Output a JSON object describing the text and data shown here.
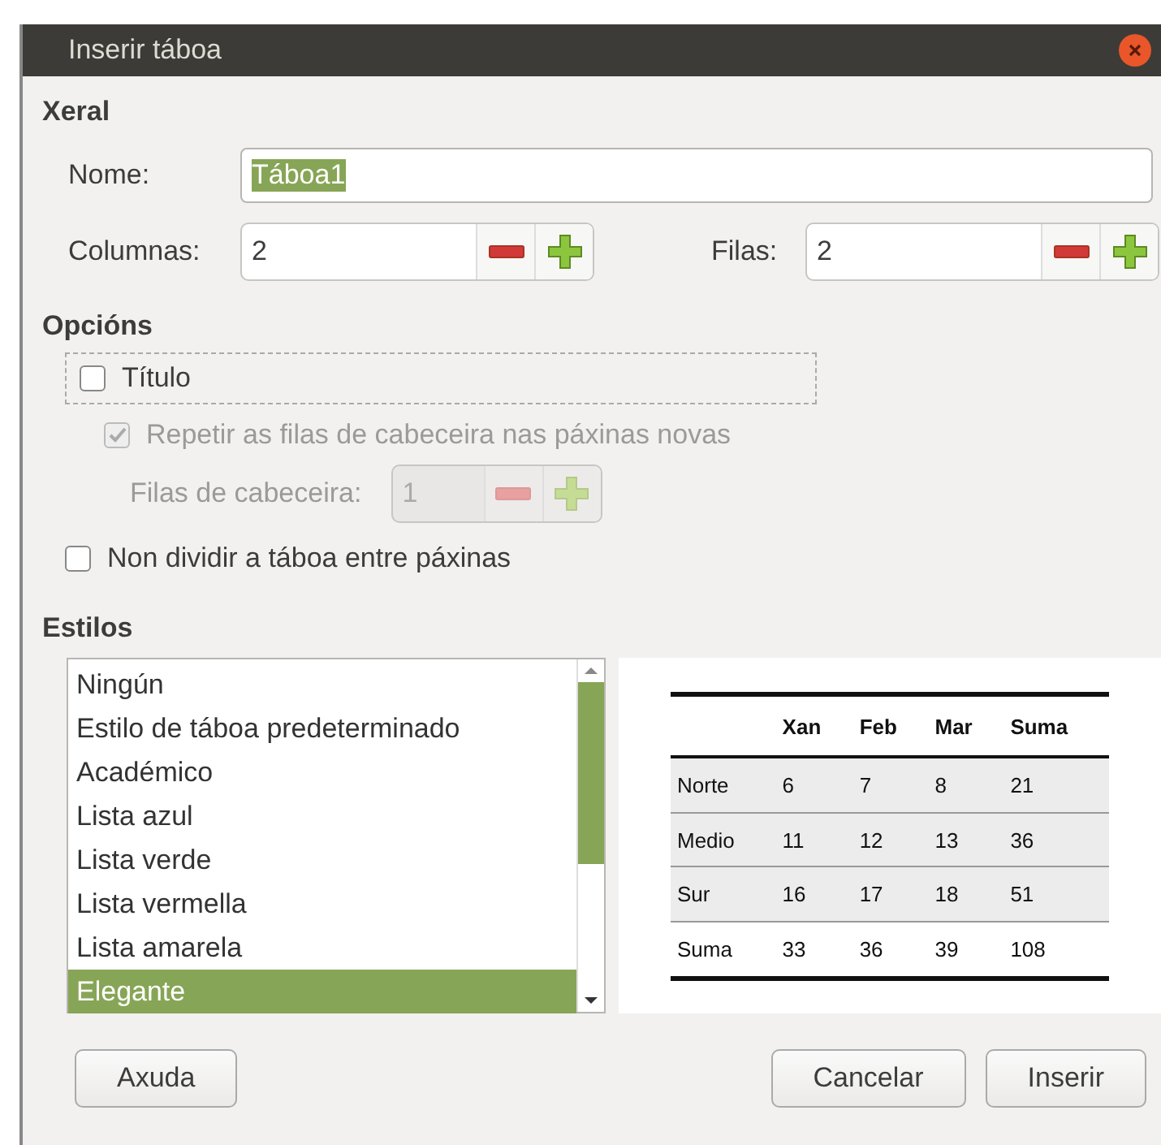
{
  "window": {
    "title": "Inserir táboa"
  },
  "general": {
    "heading": "Xeral",
    "name": {
      "label": "Nome:",
      "value": "Táboa1",
      "value_selected": true
    },
    "columns": {
      "label": "Columnas:",
      "value": "2"
    },
    "rows": {
      "label": "Filas:",
      "value": "2"
    }
  },
  "options": {
    "heading": "Opcións",
    "items": [
      {
        "kind": "checkbox",
        "label": "Título",
        "checked": false,
        "disabled": false,
        "focused": true,
        "children": [
          {
            "kind": "checkbox",
            "label": "Repetir as filas de cabeceira nas páxinas novas",
            "checked": true,
            "disabled": true
          },
          {
            "kind": "spin",
            "label": "Filas de cabeceira:",
            "value": "1",
            "disabled": true
          }
        ]
      },
      {
        "kind": "checkbox",
        "label": "Non dividir a táboa entre páxinas",
        "checked": false,
        "disabled": false
      }
    ]
  },
  "styles": {
    "heading": "Estilos",
    "items": [
      {
        "label": "Ningún",
        "selected": false
      },
      {
        "label": "Estilo de táboa predeterminado",
        "selected": false
      },
      {
        "label": "Académico",
        "selected": false
      },
      {
        "label": "Lista azul",
        "selected": false
      },
      {
        "label": "Lista verde",
        "selected": false
      },
      {
        "label": "Lista vermella",
        "selected": false
      },
      {
        "label": "Lista amarela",
        "selected": false
      },
      {
        "label": "Elegante",
        "selected": true
      }
    ],
    "preview": {
      "columns": [
        "Xan",
        "Feb",
        "Mar",
        "Suma"
      ],
      "rows": [
        {
          "label": "Norte",
          "cells": [
            "6",
            "7",
            "8",
            "21"
          ],
          "shaded": true
        },
        {
          "label": "Medio",
          "cells": [
            "11",
            "12",
            "13",
            "36"
          ],
          "shaded": true
        },
        {
          "label": "Sur",
          "cells": [
            "16",
            "17",
            "18",
            "51"
          ],
          "shaded": true
        },
        {
          "label": "Suma",
          "cells": [
            "33",
            "36",
            "39",
            "108"
          ],
          "shaded": false
        }
      ]
    }
  },
  "buttons": [
    {
      "label": "Axuda",
      "kind": "help"
    },
    {
      "label": "Cancelar",
      "kind": "action"
    },
    {
      "label": "Inserir",
      "kind": "action"
    }
  ]
}
